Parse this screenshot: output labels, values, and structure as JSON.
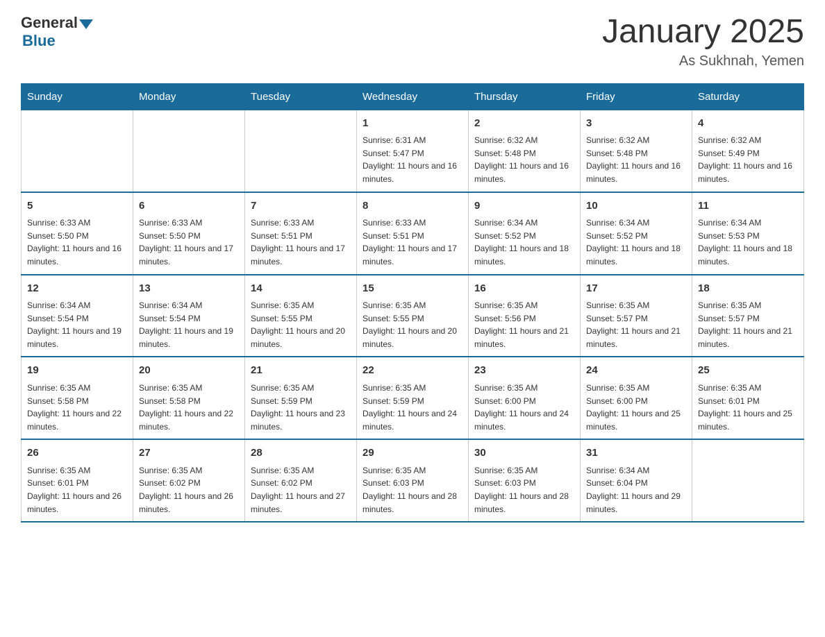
{
  "header": {
    "logo": {
      "general": "General",
      "blue": "Blue"
    },
    "title": "January 2025",
    "subtitle": "As Sukhnah, Yemen"
  },
  "days_of_week": [
    "Sunday",
    "Monday",
    "Tuesday",
    "Wednesday",
    "Thursday",
    "Friday",
    "Saturday"
  ],
  "weeks": [
    [
      {
        "day": "",
        "info": ""
      },
      {
        "day": "",
        "info": ""
      },
      {
        "day": "",
        "info": ""
      },
      {
        "day": "1",
        "info": "Sunrise: 6:31 AM\nSunset: 5:47 PM\nDaylight: 11 hours and 16 minutes."
      },
      {
        "day": "2",
        "info": "Sunrise: 6:32 AM\nSunset: 5:48 PM\nDaylight: 11 hours and 16 minutes."
      },
      {
        "day": "3",
        "info": "Sunrise: 6:32 AM\nSunset: 5:48 PM\nDaylight: 11 hours and 16 minutes."
      },
      {
        "day": "4",
        "info": "Sunrise: 6:32 AM\nSunset: 5:49 PM\nDaylight: 11 hours and 16 minutes."
      }
    ],
    [
      {
        "day": "5",
        "info": "Sunrise: 6:33 AM\nSunset: 5:50 PM\nDaylight: 11 hours and 16 minutes."
      },
      {
        "day": "6",
        "info": "Sunrise: 6:33 AM\nSunset: 5:50 PM\nDaylight: 11 hours and 17 minutes."
      },
      {
        "day": "7",
        "info": "Sunrise: 6:33 AM\nSunset: 5:51 PM\nDaylight: 11 hours and 17 minutes."
      },
      {
        "day": "8",
        "info": "Sunrise: 6:33 AM\nSunset: 5:51 PM\nDaylight: 11 hours and 17 minutes."
      },
      {
        "day": "9",
        "info": "Sunrise: 6:34 AM\nSunset: 5:52 PM\nDaylight: 11 hours and 18 minutes."
      },
      {
        "day": "10",
        "info": "Sunrise: 6:34 AM\nSunset: 5:52 PM\nDaylight: 11 hours and 18 minutes."
      },
      {
        "day": "11",
        "info": "Sunrise: 6:34 AM\nSunset: 5:53 PM\nDaylight: 11 hours and 18 minutes."
      }
    ],
    [
      {
        "day": "12",
        "info": "Sunrise: 6:34 AM\nSunset: 5:54 PM\nDaylight: 11 hours and 19 minutes."
      },
      {
        "day": "13",
        "info": "Sunrise: 6:34 AM\nSunset: 5:54 PM\nDaylight: 11 hours and 19 minutes."
      },
      {
        "day": "14",
        "info": "Sunrise: 6:35 AM\nSunset: 5:55 PM\nDaylight: 11 hours and 20 minutes."
      },
      {
        "day": "15",
        "info": "Sunrise: 6:35 AM\nSunset: 5:55 PM\nDaylight: 11 hours and 20 minutes."
      },
      {
        "day": "16",
        "info": "Sunrise: 6:35 AM\nSunset: 5:56 PM\nDaylight: 11 hours and 21 minutes."
      },
      {
        "day": "17",
        "info": "Sunrise: 6:35 AM\nSunset: 5:57 PM\nDaylight: 11 hours and 21 minutes."
      },
      {
        "day": "18",
        "info": "Sunrise: 6:35 AM\nSunset: 5:57 PM\nDaylight: 11 hours and 21 minutes."
      }
    ],
    [
      {
        "day": "19",
        "info": "Sunrise: 6:35 AM\nSunset: 5:58 PM\nDaylight: 11 hours and 22 minutes."
      },
      {
        "day": "20",
        "info": "Sunrise: 6:35 AM\nSunset: 5:58 PM\nDaylight: 11 hours and 22 minutes."
      },
      {
        "day": "21",
        "info": "Sunrise: 6:35 AM\nSunset: 5:59 PM\nDaylight: 11 hours and 23 minutes."
      },
      {
        "day": "22",
        "info": "Sunrise: 6:35 AM\nSunset: 5:59 PM\nDaylight: 11 hours and 24 minutes."
      },
      {
        "day": "23",
        "info": "Sunrise: 6:35 AM\nSunset: 6:00 PM\nDaylight: 11 hours and 24 minutes."
      },
      {
        "day": "24",
        "info": "Sunrise: 6:35 AM\nSunset: 6:00 PM\nDaylight: 11 hours and 25 minutes."
      },
      {
        "day": "25",
        "info": "Sunrise: 6:35 AM\nSunset: 6:01 PM\nDaylight: 11 hours and 25 minutes."
      }
    ],
    [
      {
        "day": "26",
        "info": "Sunrise: 6:35 AM\nSunset: 6:01 PM\nDaylight: 11 hours and 26 minutes."
      },
      {
        "day": "27",
        "info": "Sunrise: 6:35 AM\nSunset: 6:02 PM\nDaylight: 11 hours and 26 minutes."
      },
      {
        "day": "28",
        "info": "Sunrise: 6:35 AM\nSunset: 6:02 PM\nDaylight: 11 hours and 27 minutes."
      },
      {
        "day": "29",
        "info": "Sunrise: 6:35 AM\nSunset: 6:03 PM\nDaylight: 11 hours and 28 minutes."
      },
      {
        "day": "30",
        "info": "Sunrise: 6:35 AM\nSunset: 6:03 PM\nDaylight: 11 hours and 28 minutes."
      },
      {
        "day": "31",
        "info": "Sunrise: 6:34 AM\nSunset: 6:04 PM\nDaylight: 11 hours and 29 minutes."
      },
      {
        "day": "",
        "info": ""
      }
    ]
  ]
}
